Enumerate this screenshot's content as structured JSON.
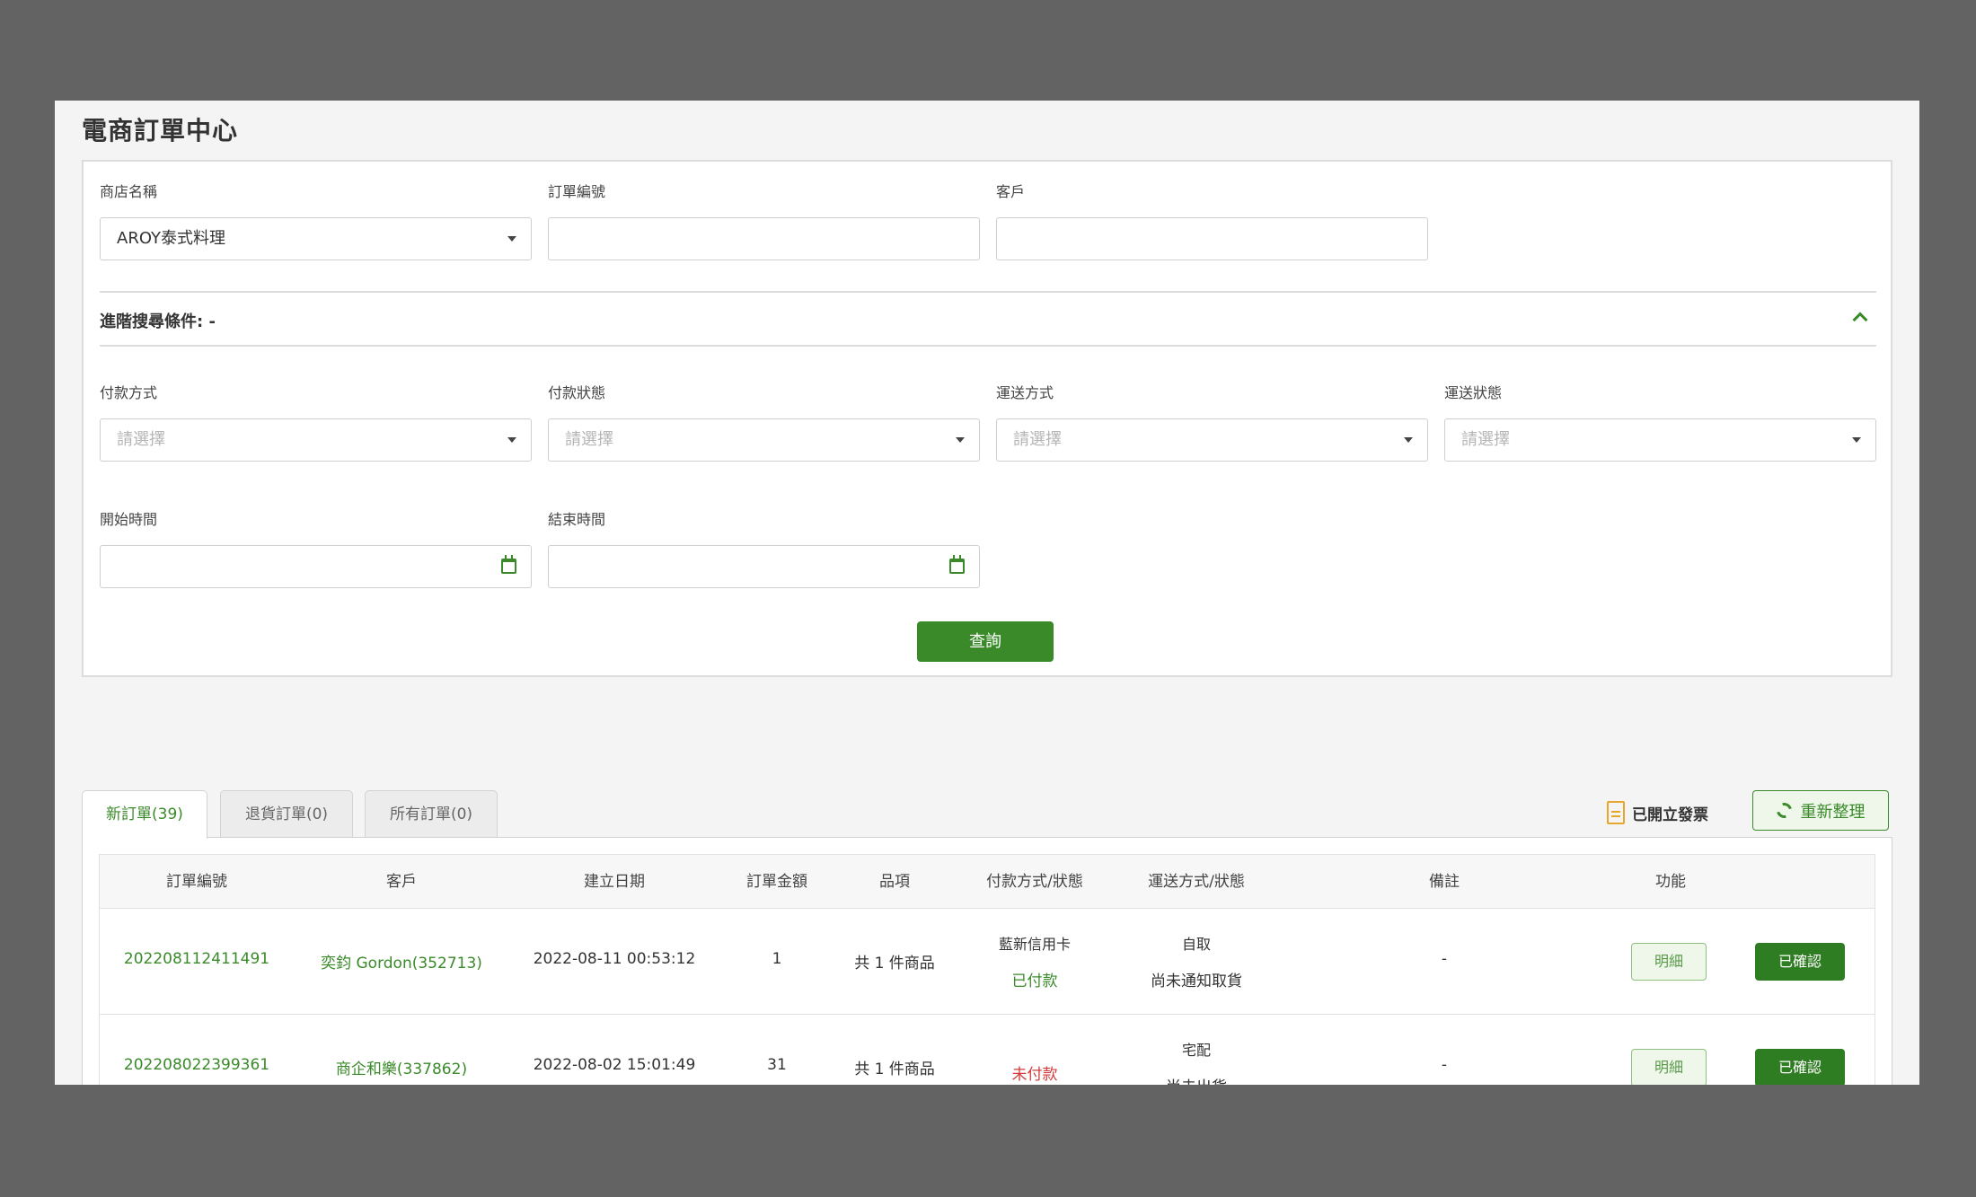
{
  "page_title": "電商訂單中心",
  "search": {
    "store_label": "商店名稱",
    "store_value": "AROY泰式料理",
    "order_no_label": "訂單編號",
    "order_no_value": "",
    "customer_label": "客戶",
    "customer_value": "",
    "advanced_title": "進階搜尋條件: -",
    "payment_method_label": "付款方式",
    "payment_status_label": "付款狀態",
    "shipping_method_label": "運送方式",
    "shipping_status_label": "運送狀態",
    "select_placeholder": "請選擇",
    "start_time_label": "開始時間",
    "end_time_label": "結束時間",
    "query_label": "查詢"
  },
  "tabs": [
    {
      "label": "新訂單(39)",
      "active": true
    },
    {
      "label": "退貨訂單(0)",
      "active": false
    },
    {
      "label": "所有訂單(0)",
      "active": false
    }
  ],
  "toolbar": {
    "invoice_label": "已開立發票",
    "refresh_label": "重新整理"
  },
  "table": {
    "headers": [
      "訂單編號",
      "客戶",
      "建立日期",
      "訂單金額",
      "品項",
      "付款方式/狀態",
      "運送方式/狀態",
      "備註",
      "功能"
    ],
    "rows": [
      {
        "order_no": "202208112411491",
        "customer": "奕鈞 Gordon(352713)",
        "created": "2022-08-11 00:53:12",
        "amount": "1",
        "items": "共 1 件商品",
        "payment_method": "藍新信用卡",
        "payment_status": "已付款",
        "shipping_method": "自取",
        "shipping_status": "尚未通知取貨",
        "note": "-",
        "detail_label": "明細",
        "confirm_label": "已確認"
      },
      {
        "order_no": "202208022399361",
        "customer": "商企和樂(337862)",
        "created": "2022-08-02 15:01:49",
        "amount": "31",
        "items": "共 1 件商品",
        "payment_method": "",
        "payment_status": "未付款",
        "shipping_method": "宅配",
        "shipping_status": "尚未出貨",
        "note": "-",
        "detail_label": "明細",
        "confirm_label": "已確認"
      }
    ]
  },
  "colors": {
    "accent": "#3a8a2a",
    "paid": "#3a8a2a",
    "unpaid": "#d23b3b"
  }
}
